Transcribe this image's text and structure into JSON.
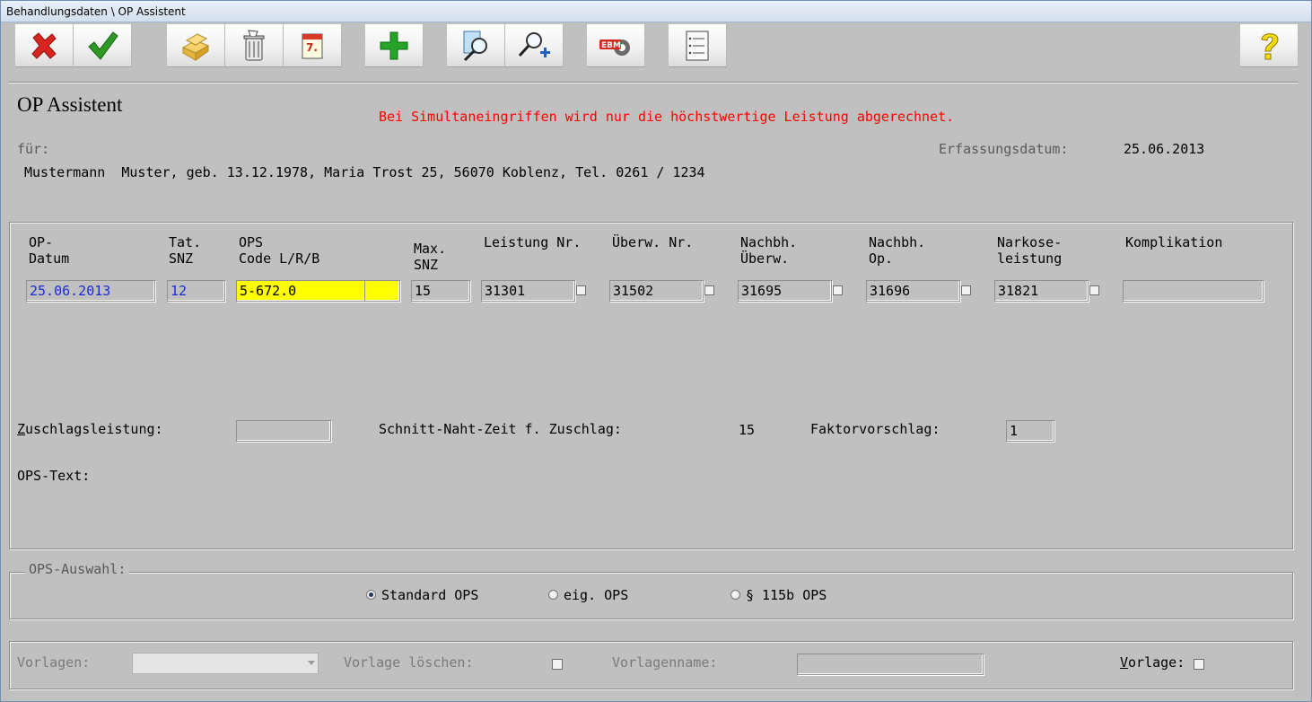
{
  "window": {
    "title": "Behandlungsdaten \\ OP Assistent"
  },
  "toolbar": {
    "buttons": [
      "cancel-icon",
      "confirm-icon",
      "folders-icon",
      "trash-icon",
      "calendar-icon",
      "add-icon",
      "search-document-icon",
      "zoom-add-icon",
      "ebm-gear-icon",
      "numbered-list-icon",
      "help-icon"
    ],
    "calendar_day": "7.",
    "ebm_label": "EBM"
  },
  "header": {
    "title": "OP Assistent",
    "warning": "Bei Simultaneingriffen wird nur die höchstwertige Leistung abgerechnet.",
    "fuer_label": "für:",
    "erfassungsdatum_label": "Erfassungsdatum:",
    "erfassungsdatum_value": "25.06.2013",
    "patient": "Mustermann  Muster, geb. 13.12.1978, Maria Trost 25, 56070 Koblenz, Tel. 0261 / 1234"
  },
  "columns": {
    "op_datum": "OP-\nDatum",
    "tat_snz": "Tat.\nSNZ",
    "ops_code": "OPS\nCode L/R/B",
    "max_snz": "Max.\nSNZ",
    "leistung_nr": "Leistung Nr.",
    "uberw_nr": "Überw. Nr.",
    "nachbh_uberw": "Nachbh.\nÜberw.",
    "nachbh_op": "Nachbh.\nOp.",
    "narkose": "Narkose-\nleistung",
    "komplikation": "Komplikation"
  },
  "row": {
    "op_datum": "25.06.2013",
    "tat_snz": "12",
    "ops_code": "5-672.0",
    "ops_side": "",
    "max_snz": "15",
    "leistung_nr": "31301",
    "uberw_nr": "31502",
    "nachbh_uberw": "31695",
    "nachbh_op": "31696",
    "narkose": "31821",
    "komplikation": ""
  },
  "zuschlag": {
    "label_hotkey": "Z",
    "label_rest": "uschlagsleistung:",
    "value": "",
    "schnitt_label": "Schnitt-Naht-Zeit f. Zuschlag:",
    "schnitt_value": "15",
    "faktor_label": "Faktorvorschlag:",
    "faktor_value": "1"
  },
  "ops_text": {
    "label": "OPS-Text:"
  },
  "ops_auswahl": {
    "caption": "OPS-Auswahl:",
    "options": [
      "Standard OPS",
      "eig. OPS",
      "§ 115b OPS"
    ],
    "selected": "Standard OPS"
  },
  "vorlagen": {
    "vorlagen_label": "Vorlagen:",
    "loeschen_label": "Vorlage löschen:",
    "name_label": "Vorlagenname:",
    "vorlage_hotkey": "V",
    "vorlage_rest": "orlage:"
  }
}
